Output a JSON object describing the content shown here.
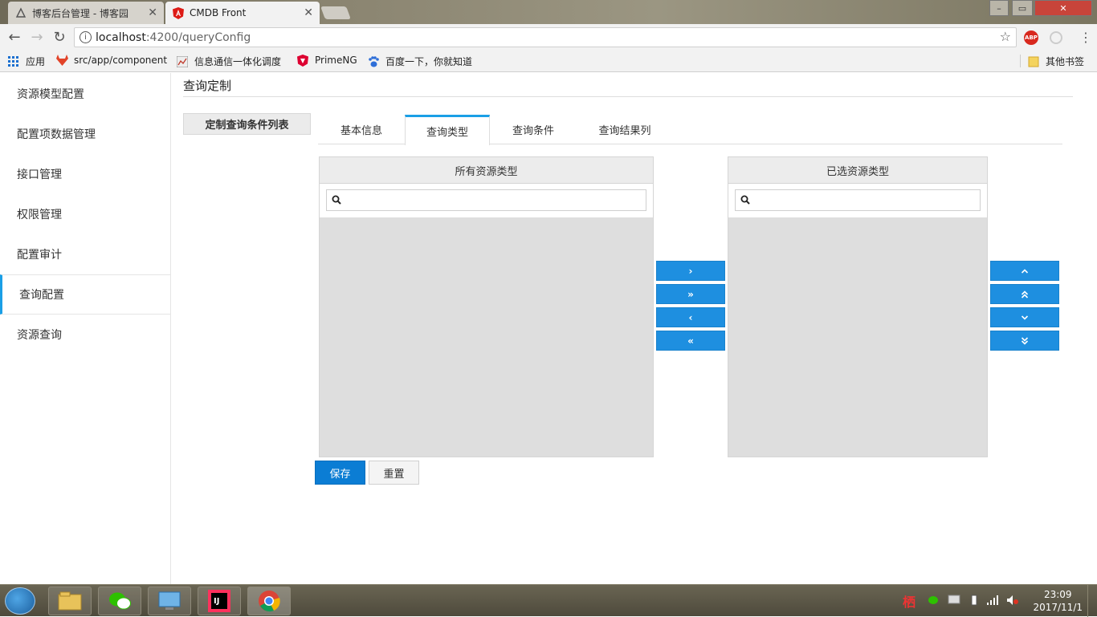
{
  "browser": {
    "tabs": [
      {
        "title": "博客后台管理 - 博客园",
        "active": false
      },
      {
        "title": "CMDB Front",
        "active": true
      }
    ],
    "url_host": "localhost",
    "url_rest": ":4200/queryConfig",
    "bookmarks": [
      {
        "label": "应用",
        "icon": "apps-grid-icon"
      },
      {
        "label": "src/app/component",
        "icon": "gitlab-icon"
      },
      {
        "label": "信息通信一体化调度",
        "icon": "chart-icon"
      },
      {
        "label": "PrimeNG",
        "icon": "primeng-shield-icon"
      },
      {
        "label": "百度一下，你就知道",
        "icon": "baidu-paw-icon"
      },
      {
        "label": "其他书签",
        "icon": "folder-icon"
      }
    ]
  },
  "sidebar": {
    "items": [
      {
        "label": "资源模型配置",
        "active": false
      },
      {
        "label": "配置项数据管理",
        "active": false
      },
      {
        "label": "接口管理",
        "active": false
      },
      {
        "label": "权限管理",
        "active": false
      },
      {
        "label": "配置审计",
        "active": false
      },
      {
        "label": "查询配置",
        "active": true
      },
      {
        "label": "资源查询",
        "active": false
      }
    ]
  },
  "main": {
    "title": "查询定制",
    "left_panel_tab": "定制查询条件列表",
    "tabs": [
      {
        "label": "基本信息",
        "active": false
      },
      {
        "label": "查询类型",
        "active": true
      },
      {
        "label": "查询条件",
        "active": false
      },
      {
        "label": "查询结果列",
        "active": false
      }
    ],
    "source_list": {
      "header": "所有资源类型",
      "filter_value": ""
    },
    "target_list": {
      "header": "已选资源类型",
      "filter_value": ""
    },
    "transfer_buttons": [
      "›",
      "»",
      "‹",
      "«"
    ],
    "order_buttons": [
      "ˆ",
      "⌃⌃",
      "ˇ",
      "⌄⌄"
    ],
    "save_label": "保存",
    "reset_label": "重置"
  },
  "taskbar": {
    "time": "23:09",
    "date": "2017/11/1"
  },
  "colors": {
    "accent": "#1a9fe6",
    "button_blue": "#1e8fe0",
    "save_blue": "#0b7dd4",
    "list_bg": "#dedede"
  }
}
